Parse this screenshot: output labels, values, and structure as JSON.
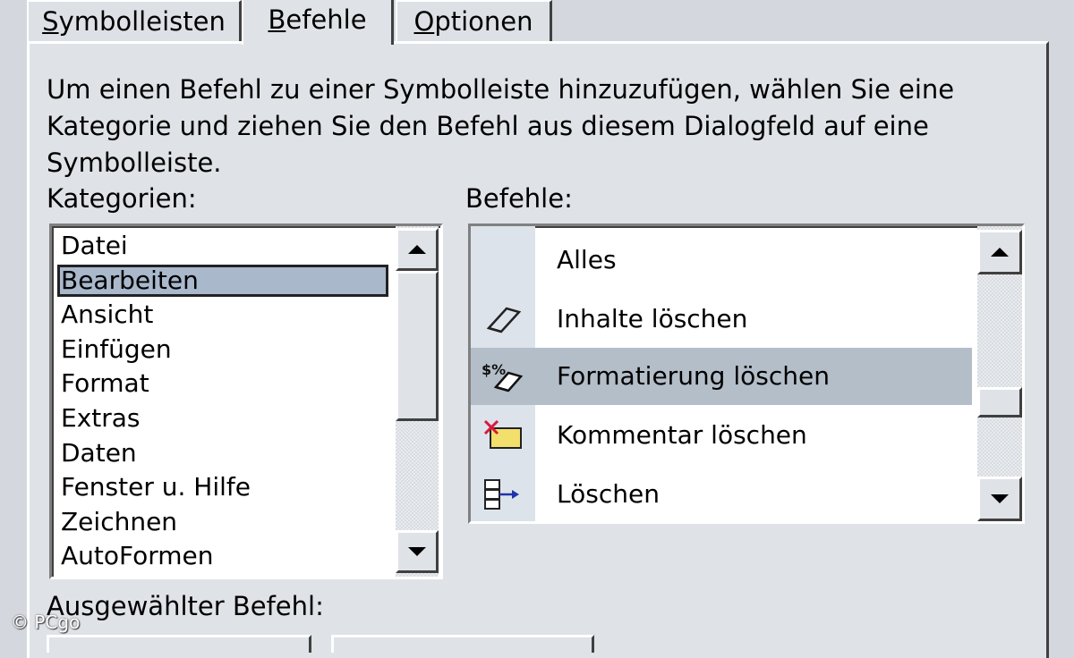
{
  "tabs": [
    {
      "label": "Symbolleisten",
      "underline": "S",
      "rest": "ymbolleisten"
    },
    {
      "label": "Befehle",
      "underline": "B",
      "rest": "efehle"
    },
    {
      "label": "Optionen",
      "underline": "O",
      "rest": "ptionen"
    }
  ],
  "active_tab": "Befehle",
  "description": "Um einen Befehl zu einer Symbolleiste hinzuzufügen, wählen Sie eine Kategorie und ziehen Sie den Befehl aus diesem Dialogfeld auf eine Symbolleiste.",
  "categories_label": "Kategorien:",
  "categories": [
    "Datei",
    "Bearbeiten",
    "Ansicht",
    "Einfügen",
    "Format",
    "Extras",
    "Daten",
    "Fenster u. Hilfe",
    "Zeichnen",
    "AutoFormen"
  ],
  "selected_category": "Bearbeiten",
  "commands_label": "Befehle:",
  "commands": [
    {
      "label": "Alles",
      "icon": "none"
    },
    {
      "label": "Inhalte löschen",
      "icon": "eraser-icon"
    },
    {
      "label": "Formatierung löschen",
      "icon": "clear-formats-icon"
    },
    {
      "label": "Kommentar löschen",
      "icon": "delete-comment-icon"
    },
    {
      "label": "Löschen",
      "icon": "delete-cells-icon"
    }
  ],
  "selected_command": "Formatierung löschen",
  "selected_command_label": "Ausgewählter Befehl:",
  "watermark": "© PCgo",
  "colors": {
    "selection": "#aab8cc",
    "dialog": "#dfe2e6"
  }
}
